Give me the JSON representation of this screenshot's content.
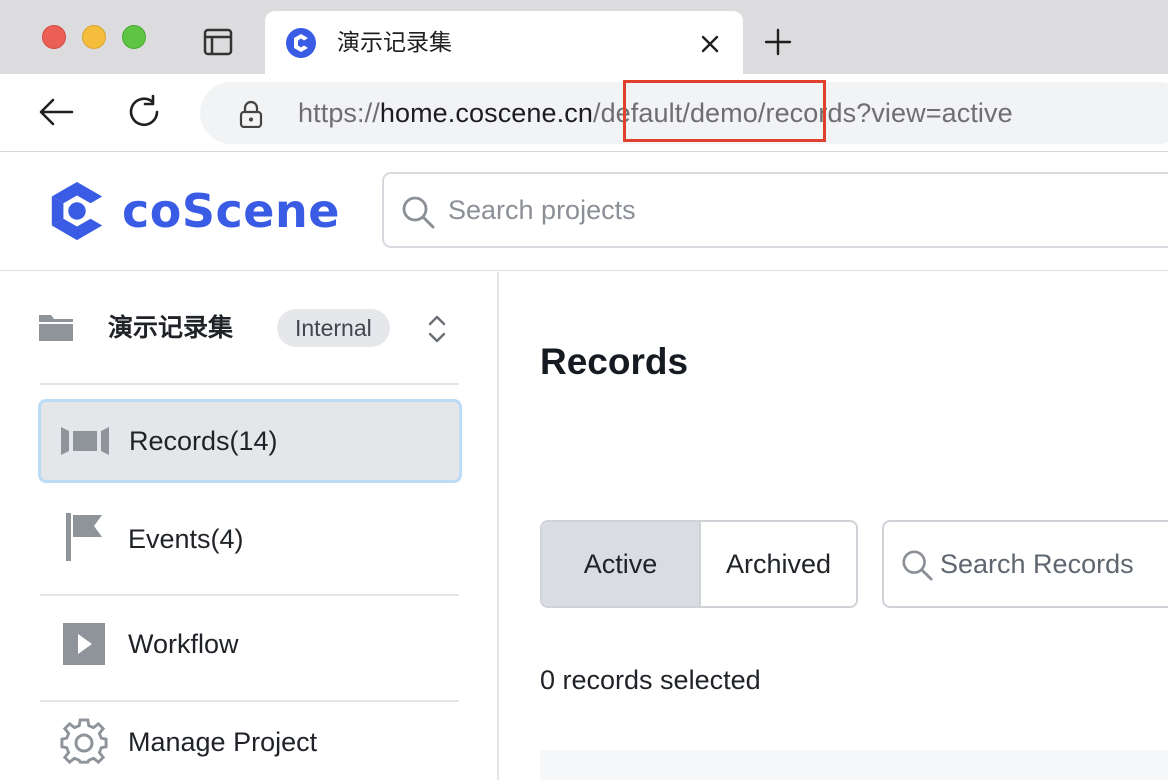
{
  "browser": {
    "tab_title": "演示记录集",
    "url_scheme": "https://",
    "url_host": "home.coscene.cn",
    "url_path": "/default/demo/records?view=active"
  },
  "header": {
    "logo_text": "coScene",
    "search_placeholder": "Search projects"
  },
  "sidebar": {
    "project_name": "演示记录集",
    "project_badge": "Internal",
    "items": [
      {
        "label": "Records(14)",
        "icon": "records-icon",
        "active": true
      },
      {
        "label": "Events(4)",
        "icon": "flag-icon",
        "active": false
      },
      {
        "label": "Workflow",
        "icon": "play-icon",
        "active": false
      },
      {
        "label": "Manage Project",
        "icon": "gear-icon",
        "active": false
      }
    ]
  },
  "main": {
    "title": "Records",
    "tabs": [
      {
        "label": "Active",
        "selected": true
      },
      {
        "label": "Archived",
        "selected": false
      }
    ],
    "search_placeholder": "Search Records",
    "selected_count_text": "0 records selected"
  },
  "colors": {
    "brand": "#3a5ce5",
    "highlight": "#e0412e",
    "active_border": "#bcdcf6"
  }
}
